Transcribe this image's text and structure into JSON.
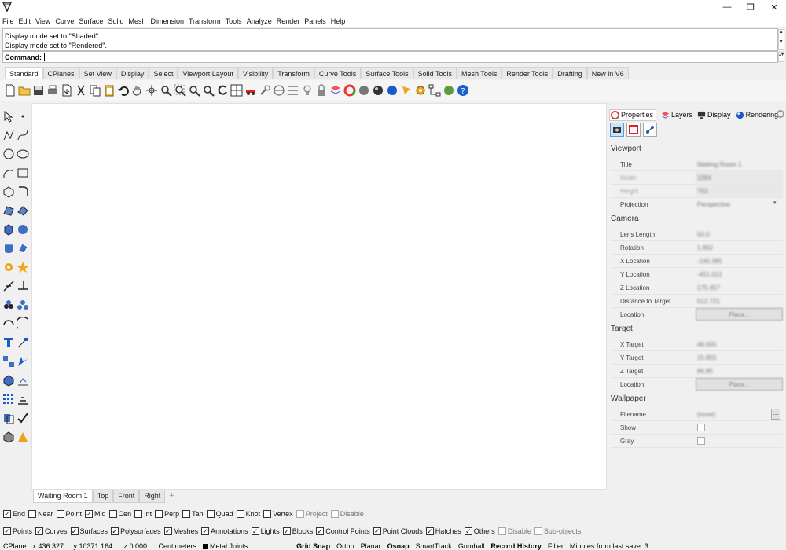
{
  "titlebar": {
    "minimize": "—",
    "restore": "❐",
    "close": "✕"
  },
  "menu": [
    "File",
    "Edit",
    "View",
    "Curve",
    "Surface",
    "Solid",
    "Mesh",
    "Dimension",
    "Transform",
    "Tools",
    "Analyze",
    "Render",
    "Panels",
    "Help"
  ],
  "history": {
    "lines": [
      "Display mode set to \"Shaded\".",
      "Display mode set to \"Rendered\"."
    ]
  },
  "command": {
    "label": "Command:",
    "value": ""
  },
  "tabs": [
    "Standard",
    "CPlanes",
    "Set View",
    "Display",
    "Select",
    "Viewport Layout",
    "Visibility",
    "Transform",
    "Curve Tools",
    "Surface Tools",
    "Solid Tools",
    "Mesh Tools",
    "Render Tools",
    "Drafting",
    "New in V6"
  ],
  "active_tab": "Standard",
  "viewport_tabs": [
    "Waiting Room 1",
    "Top",
    "Front",
    "Right"
  ],
  "viewport_add": "+",
  "panel": {
    "tabs": [
      "Properties",
      "Layers",
      "Display",
      "Rendering"
    ],
    "sections": {
      "viewport": "Viewport",
      "camera": "Camera",
      "target": "Target",
      "wallpaper": "Wallpaper"
    },
    "viewport_rows": {
      "title": {
        "label": "Title",
        "value": "Waiting Room 1"
      },
      "width": {
        "label": "Width",
        "value": "1094"
      },
      "height": {
        "label": "Height",
        "value": "753"
      },
      "projection": {
        "label": "Projection",
        "value": "Perspective"
      }
    },
    "camera_rows": {
      "lens": {
        "label": "Lens Length",
        "value": "50.0"
      },
      "rotation": {
        "label": "Rotation",
        "value": "1.862"
      },
      "xloc": {
        "label": "X Location",
        "value": "-145.395"
      },
      "yloc": {
        "label": "Y Location",
        "value": "-451.012"
      },
      "zloc": {
        "label": "Z Location",
        "value": "175.657"
      },
      "dist": {
        "label": "Distance to Target",
        "value": "512.721"
      },
      "location": {
        "label": "Location",
        "value": "Place..."
      }
    },
    "target_rows": {
      "x": {
        "label": "X Target",
        "value": "48.655"
      },
      "y": {
        "label": "Y Target",
        "value": "15.855"
      },
      "z": {
        "label": "Z Target",
        "value": "86.85"
      },
      "location": {
        "label": "Location",
        "value": "Place..."
      }
    },
    "wallpaper_rows": {
      "filename": {
        "label": "Filename",
        "value": "(none)",
        "button": "..."
      },
      "show": {
        "label": "Show"
      },
      "gray": {
        "label": "Gray"
      }
    }
  },
  "osnap": [
    {
      "label": "End",
      "checked": true
    },
    {
      "label": "Near",
      "checked": false
    },
    {
      "label": "Point",
      "checked": false
    },
    {
      "label": "Mid",
      "checked": true
    },
    {
      "label": "Cen",
      "checked": false
    },
    {
      "label": "Int",
      "checked": false
    },
    {
      "label": "Perp",
      "checked": false
    },
    {
      "label": "Tan",
      "checked": false
    },
    {
      "label": "Quad",
      "checked": false
    },
    {
      "label": "Knot",
      "checked": false
    },
    {
      "label": "Vertex",
      "checked": false
    },
    {
      "label": "Project",
      "checked": false,
      "disabled": true
    },
    {
      "label": "Disable",
      "checked": false,
      "disabled": true
    }
  ],
  "filters": [
    {
      "label": "Points",
      "checked": true
    },
    {
      "label": "Curves",
      "checked": true
    },
    {
      "label": "Surfaces",
      "checked": true
    },
    {
      "label": "Polysurfaces",
      "checked": true
    },
    {
      "label": "Meshes",
      "checked": true
    },
    {
      "label": "Annotations",
      "checked": true
    },
    {
      "label": "Lights",
      "checked": true
    },
    {
      "label": "Blocks",
      "checked": true
    },
    {
      "label": "Control Points",
      "checked": true
    },
    {
      "label": "Point Clouds",
      "checked": true
    },
    {
      "label": "Hatches",
      "checked": true
    },
    {
      "label": "Others",
      "checked": true
    },
    {
      "label": "Disable",
      "checked": false,
      "disabled": true
    },
    {
      "label": "Sub-objects",
      "checked": false,
      "disabled": true
    }
  ],
  "status": {
    "cplane": "CPlane",
    "x": "x 436.327",
    "y": "y 10371.164",
    "z": "z 0.000",
    "units": "Centimeters",
    "layer": "Metal Joints",
    "grid_snap": "Grid Snap",
    "ortho": "Ortho",
    "planar": "Planar",
    "osnap": "Osnap",
    "smarttrack": "SmartTrack",
    "gumball": "Gumball",
    "record_history": "Record History",
    "filter": "Filter",
    "save_info": "Minutes from last save: 3"
  },
  "colors": {
    "accent": "#569de5",
    "viewport_bg": "#ffffff",
    "chrome_bg": "#f0f0f0"
  }
}
